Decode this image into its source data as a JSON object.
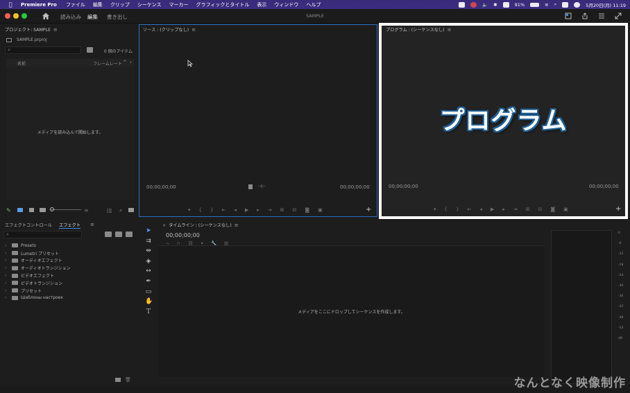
{
  "menubar": {
    "app": "Premiere Pro",
    "items": [
      "ファイル",
      "編集",
      "クリップ",
      "シーケンス",
      "マーカー",
      "グラフィックとタイトル",
      "表示",
      "ウィンドウ",
      "ヘルプ"
    ],
    "battery": "91%",
    "datetime": "5月20日(月) 11:19"
  },
  "header": {
    "tabs": [
      "読み込み",
      "編集",
      "書き出し"
    ],
    "active_tab": "編集",
    "project_title": "SAMPLE"
  },
  "project_panel": {
    "title": "プロジェクト: SAMPLE",
    "file_name": "SAMPLE.prproj",
    "item_count": "0 個のアイテム",
    "col_name": "名前",
    "col_framerate": "フレームレート",
    "empty_text": "メディアを読み込んで開始します。"
  },
  "source_monitor": {
    "title": "ソース : (クリップなし)",
    "timecode_left": "00;00;00;00",
    "timecode_right": "00;00;00;00"
  },
  "program_monitor": {
    "title": "プログラム : (シーケンスなし)",
    "timecode_left": "00;00;00;00",
    "timecode_right": "00;00;00;00",
    "overlay_label": "プログラム"
  },
  "effects_panel": {
    "tab_controls": "エフェクトコントロール",
    "tab_effects": "エフェクト",
    "items": [
      "Presets",
      "Lumetri プリセット",
      "オーディオエフェクト",
      "オーディオトランジション",
      "ビデオエフェクト",
      "ビデオトランジション",
      "プリセット",
      "Шаблоны настроек"
    ]
  },
  "timeline": {
    "title": "タイムライン : (シーケンスなし)",
    "timecode": "00;00;00;00",
    "empty_text": "メディアをここにドロップしてシーケンスを作成します。"
  },
  "audio_meter": {
    "scale": [
      "0",
      "-6",
      "-12",
      "-18",
      "-24",
      "-30",
      "-36",
      "-42",
      "-48",
      "-54",
      "dB"
    ]
  },
  "watermark": "なんとなく映像制作",
  "colors": {
    "accent": "#3a8ee6",
    "menubar": "#3c2d80",
    "overlay_stroke": "#1f5f97"
  }
}
